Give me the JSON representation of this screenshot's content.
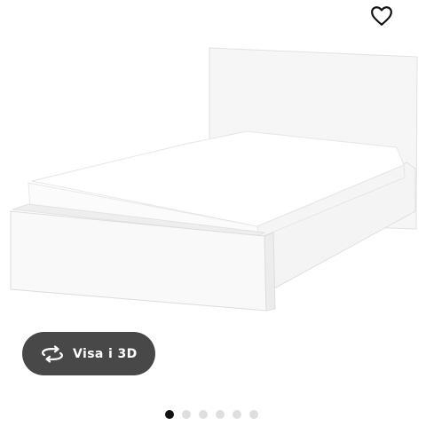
{
  "product": {
    "image_icon": "bed-frame-white-product-photo"
  },
  "favorite": {
    "icon": "heart-outline-icon"
  },
  "view3d": {
    "label": "Visa i 3D",
    "icon": "rotate-arrows-icon"
  },
  "carousel": {
    "total": 6,
    "active_index": 0
  },
  "colors": {
    "button_bg": "#484848",
    "dot_active": "#111111",
    "dot_inactive": "#dfdfdf"
  }
}
